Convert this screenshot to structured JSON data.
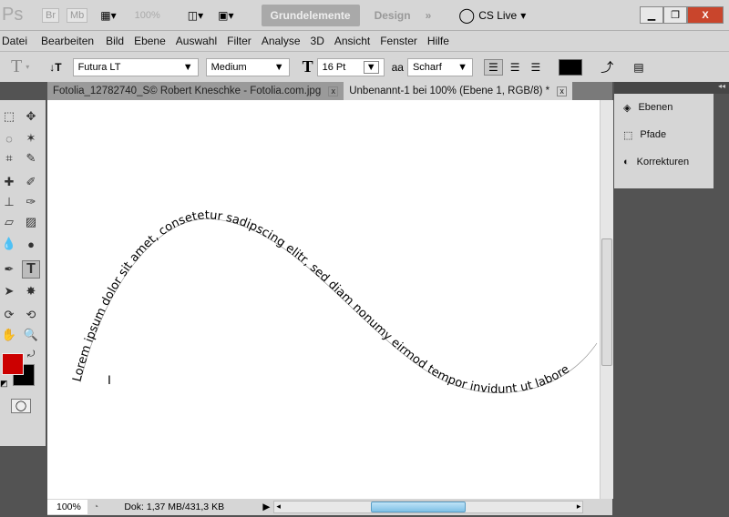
{
  "appbar": {
    "logo": "Ps",
    "bridge": "Br",
    "minibridge": "Mb",
    "zoom": "100%",
    "workspace_active": "Grundelemente",
    "workspace_other": "Design",
    "more": "»",
    "cslive": "CS Live"
  },
  "menu": [
    "Datei",
    "Bearbeiten",
    "Bild",
    "Ebene",
    "Auswahl",
    "Filter",
    "Analyse",
    "3D",
    "Ansicht",
    "Fenster",
    "Hilfe"
  ],
  "options": {
    "font_family": "Futura LT",
    "font_style": "Medium",
    "font_size": "16 Pt",
    "aa_label": "aa",
    "antialias": "Scharf",
    "text_color": "#000000"
  },
  "tabs": [
    {
      "label": "Fotolia_12782740_S© Robert Kneschke - Fotolia.com.jpg",
      "active": false
    },
    {
      "label": "Unbenannt-1 bei 100% (Ebene 1, RGB/8) *",
      "active": true
    }
  ],
  "canvas": {
    "path_text": "Lorem ipsum dolor sit amet, consetetur sadipscing elitr, sed diam nonumy eirmod tempor invidunt ut labore"
  },
  "colors": {
    "foreground": "#cc0000",
    "background": "#000000"
  },
  "status": {
    "zoom": "100%",
    "doc": "Dok: 1,37 MB/431,3 KB"
  },
  "panels": [
    {
      "label": "Ebenen",
      "icon": "layers-icon"
    },
    {
      "label": "Pfade",
      "icon": "paths-icon"
    },
    {
      "label": "Korrekturen",
      "icon": "adjustments-icon"
    }
  ]
}
